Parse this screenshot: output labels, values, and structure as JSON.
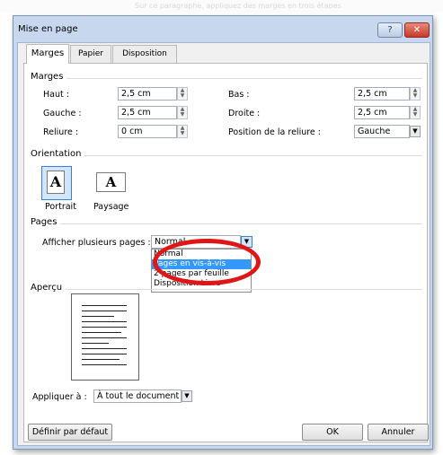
{
  "top_caption": "Sur ce paragraphe, appliquez des marges en trois étapes",
  "window": {
    "title": "Mise en page",
    "help_glyph": "?",
    "close_glyph": "✕"
  },
  "tabs": [
    {
      "label": "Marges"
    },
    {
      "label": "Papier"
    },
    {
      "label": "Disposition"
    }
  ],
  "marges": {
    "group_title": "Marges",
    "haut": {
      "label": "Haut :",
      "value": "2,5 cm"
    },
    "gauche": {
      "label": "Gauche :",
      "value": "2,5 cm"
    },
    "reliure": {
      "label": "Reliure :",
      "value": "0 cm"
    },
    "bas": {
      "label": "Bas :",
      "value": "2,5 cm"
    },
    "droite": {
      "label": "Droite :",
      "value": "2,5 cm"
    },
    "position_reliure": {
      "label": "Position de la reliure :",
      "value": "Gauche"
    }
  },
  "orientation": {
    "group_title": "Orientation",
    "portrait_label": "Portrait",
    "paysage_label": "Paysage",
    "glyph": "A"
  },
  "pages": {
    "group_title": "Pages",
    "afficher_label": "Afficher plusieurs pages :",
    "selected": "Normal",
    "options": [
      "Normal",
      "Pages en vis-à-vis",
      "2 pages par feuille",
      "Disposition Livre"
    ],
    "highlighted_index": 1
  },
  "apercu": {
    "group_title": "Aperçu"
  },
  "appliquer": {
    "label": "Appliquer à :",
    "value": "À tout le document"
  },
  "buttons": {
    "default": "Définir par défaut",
    "ok": "OK",
    "cancel": "Annuler"
  },
  "colors": {
    "highlight_circle": "#e01515",
    "selection": "#3399ff"
  }
}
